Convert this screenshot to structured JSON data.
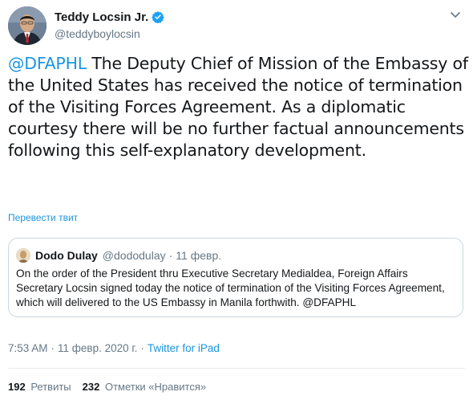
{
  "author": {
    "display_name": "Teddy Locsin Jr.",
    "handle": "@teddyboylocsin",
    "verified": true
  },
  "tweet": {
    "mention": "@DFAPHL",
    "text": " The Deputy Chief of Mission of the Embassy of the United States has received the notice of termination of the Visiting Forces Agreement. As a diplomatic courtesy there will be no further factual announcements following this self-explanatory development.",
    "translate_label": "Перевести твит"
  },
  "quoted_tweet": {
    "display_name": "Dodo Dulay",
    "handle": "@dododulay",
    "separator": "·",
    "date": "11 февр.",
    "text": "On the order of the President thru Executive Secretary Medialdea, Foreign Affairs Secretary Locsin signed today the notice of termination of the Visiting Forces Agreement, which will delivered to the US Embassy in Manila forthwith. @DFAPHL"
  },
  "meta": {
    "time": "7:53 AM",
    "separator1": "·",
    "date": "11 февр. 2020 г.",
    "separator2": "·",
    "source": "Twitter for iPad"
  },
  "stats": {
    "retweets_count": "192",
    "retweets_label": "Ретвиты",
    "likes_count": "232",
    "likes_label": "Отметки «Нравится»"
  },
  "colors": {
    "link": "#1b95e0",
    "secondary_text": "#657786",
    "primary_text": "#14171a",
    "border": "#ccd6dd",
    "verified_badge": "#1da1f2"
  },
  "icons": {
    "verified": "verified-badge-icon",
    "more": "chevron-down-icon"
  }
}
